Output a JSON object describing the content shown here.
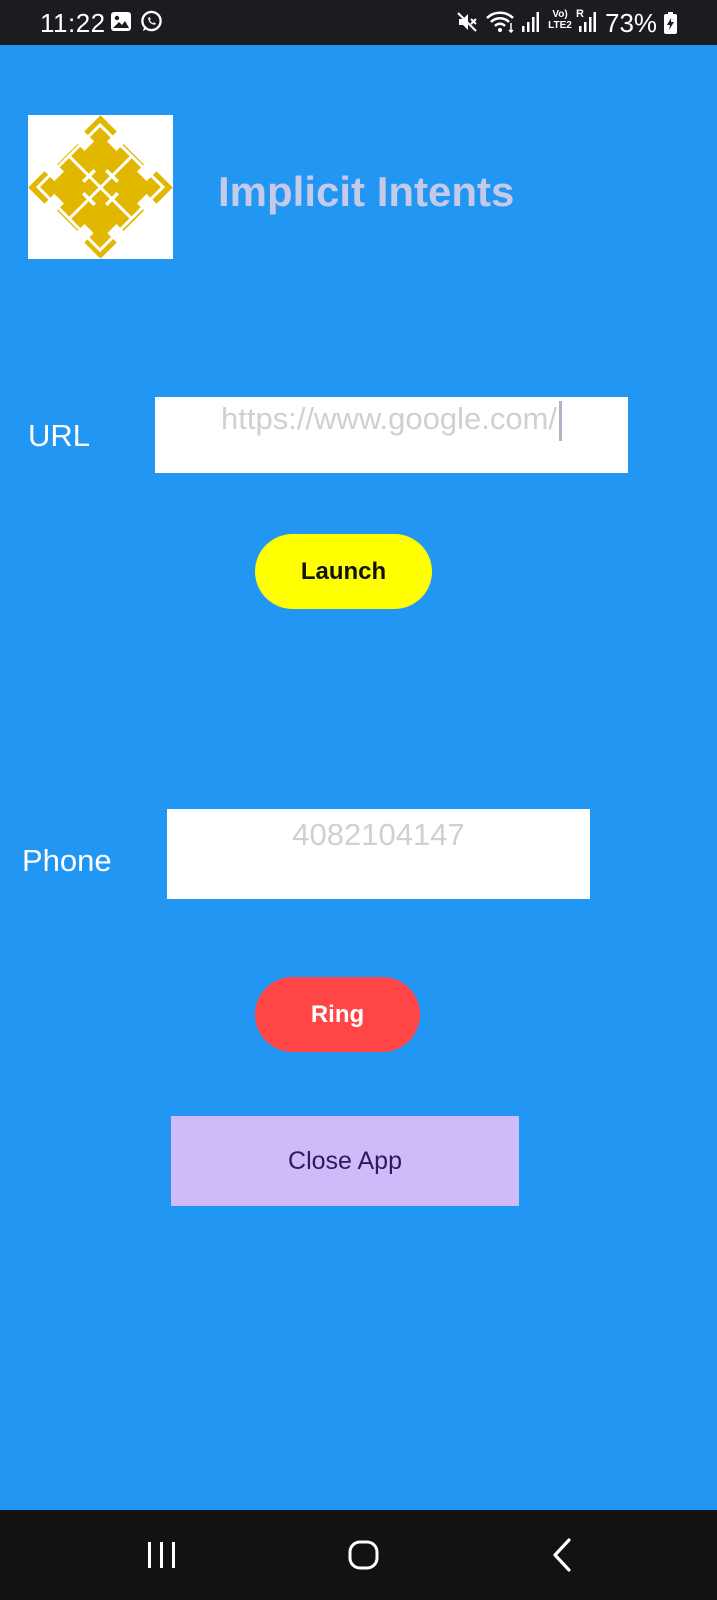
{
  "status_bar": {
    "time": "11:22",
    "battery": "73%",
    "volte": "Vo)",
    "lte": "LTE2",
    "roaming": "R",
    "icons": [
      "gallery-icon",
      "whatsapp-icon",
      "mute-icon",
      "wifi-icon",
      "signal-icon",
      "volte-icon",
      "signal-icon",
      "battery-charging-icon"
    ]
  },
  "header": {
    "title": "Implicit Intents",
    "logo_icon": "diamond-lattice-logo",
    "logo_color": "#E2B700"
  },
  "url_row": {
    "label": "URL",
    "hint": "https://www.google.com/"
  },
  "launch_button": {
    "label": "Launch",
    "color": "#FFFF00"
  },
  "phone_row": {
    "label": "Phone",
    "hint": "4082104147"
  },
  "ring_button": {
    "label": "Ring",
    "color": "#FF4545"
  },
  "close_button": {
    "label": "Close App",
    "color": "#CFBBFA"
  },
  "nav_bar": {
    "buttons": [
      "recents-icon",
      "home-icon",
      "back-icon"
    ]
  },
  "colors": {
    "background": "#2196F3",
    "title": "#C5CAE9"
  }
}
